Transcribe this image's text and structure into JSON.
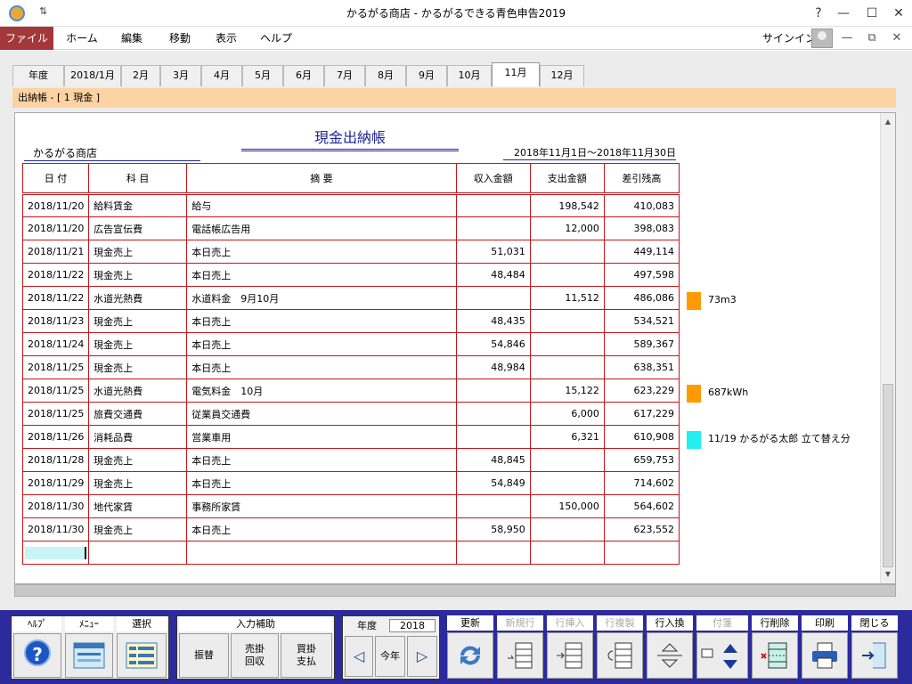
{
  "window": {
    "title": "かるがる商店 - かるがるできる青色申告2019",
    "quick_access": "⇅",
    "help_btn": "?",
    "min_btn": "—",
    "max_btn": "☐",
    "close_btn": "✕"
  },
  "ribbon": {
    "tabs": [
      "ファイル",
      "ホーム",
      "編集",
      "移動",
      "表示",
      "ヘルプ"
    ],
    "signin": "サインイン",
    "ribbon_min": "—",
    "ribbon_restore": "⧉",
    "ribbon_close": "✕"
  },
  "month_tabs": [
    "年度",
    "2018/1月",
    "2月",
    "3月",
    "4月",
    "5月",
    "6月",
    "7月",
    "8月",
    "9月",
    "10月",
    "11月",
    "12月"
  ],
  "active_tab": "11月",
  "breadcrumb": "出納帳 - [ 1 現金 ]",
  "report": {
    "title": "現金出納帳",
    "shop": "かるがる商店",
    "period": "2018年11月1日～2018年11月30日"
  },
  "table": {
    "headers": [
      "日 付",
      "科 目",
      "摘 要",
      "収入金額",
      "支出金額",
      "差引残高"
    ],
    "rows": [
      [
        "2018/11/20",
        "給料賃金",
        "給与",
        "",
        "198,542",
        "410,083"
      ],
      [
        "2018/11/20",
        "広告宣伝費",
        "電話帳広告用",
        "",
        "12,000",
        "398,083"
      ],
      [
        "2018/11/21",
        "現金売上",
        "本日売上",
        "51,031",
        "",
        "449,114"
      ],
      [
        "2018/11/22",
        "現金売上",
        "本日売上",
        "48,484",
        "",
        "497,598"
      ],
      [
        "2018/11/22",
        "水道光熱費",
        "水道料金　9月10月",
        "",
        "11,512",
        "486,086"
      ],
      [
        "2018/11/23",
        "現金売上",
        "本日売上",
        "48,435",
        "",
        "534,521"
      ],
      [
        "2018/11/24",
        "現金売上",
        "本日売上",
        "54,846",
        "",
        "589,367"
      ],
      [
        "2018/11/25",
        "現金売上",
        "本日売上",
        "48,984",
        "",
        "638,351"
      ],
      [
        "2018/11/25",
        "水道光熱費",
        "電気料金　10月",
        "",
        "15,122",
        "623,229"
      ],
      [
        "2018/11/25",
        "旅費交通費",
        "従業員交通費",
        "",
        "6,000",
        "617,229"
      ],
      [
        "2018/11/26",
        "消耗品費",
        "営業車用",
        "",
        "6,321",
        "610,908"
      ],
      [
        "2018/11/28",
        "現金売上",
        "本日売上",
        "48,845",
        "",
        "659,753"
      ],
      [
        "2018/11/29",
        "現金売上",
        "本日売上",
        "54,849",
        "",
        "714,602"
      ],
      [
        "2018/11/30",
        "地代家賃",
        "事務所家賃",
        "",
        "150,000",
        "564,602"
      ],
      [
        "2018/11/30",
        "現金売上",
        "本日売上",
        "58,950",
        "",
        "623,552"
      ]
    ]
  },
  "memos": [
    {
      "row": 4,
      "color": "#ff9a00",
      "text": "73m3"
    },
    {
      "row": 8,
      "color": "#ff9a00",
      "text": "687kWh"
    },
    {
      "row": 10,
      "color": "#22eeee",
      "text": "11/19  かるがる太郎  立て替え分"
    }
  ],
  "toolbar": {
    "help": "ﾍﾙﾌﾟ",
    "menu": "ﾒﾆｭｰ",
    "select": "選択",
    "input_assist": "入力補助",
    "furikae": "振替",
    "urikake_1": "売掛",
    "urikake_2": "回収",
    "kaikake_1": "買掛",
    "kaikake_2": "支払",
    "year_label": "年度",
    "year_value": "2018",
    "today": "今年",
    "prev": "◁",
    "next": "▷",
    "update": "更新",
    "new_row": "新規行",
    "insert_row": "行挿入",
    "copy_row": "行複製",
    "swap_row": "行入換",
    "tag": "付箋",
    "delete_row": "行削除",
    "print": "印刷",
    "close": "閉じる"
  }
}
